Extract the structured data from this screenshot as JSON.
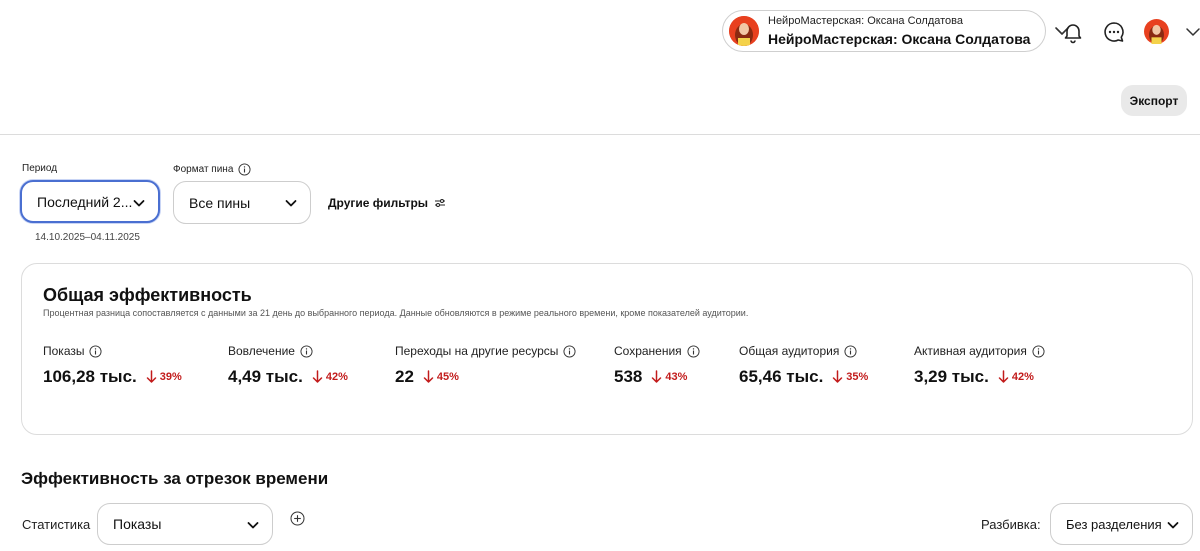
{
  "header": {
    "account_small": "НейроМастерская: Оксана Солдатова",
    "account_main": "НейроМастерская: Оксана Солдатова",
    "icons": [
      "bell-icon",
      "chat-icon",
      "profile-avatar",
      "chevron-down-icon"
    ],
    "export_label": "Экспорт"
  },
  "filters": {
    "period_label": "Период",
    "period_value": "Последний 2...",
    "period_range": "14.10.2025–04.11.2025",
    "format_label": "Формат пина",
    "format_value": "Все пины",
    "other_filters_label": "Другие фильтры"
  },
  "overview": {
    "title": "Общая эффективность",
    "subtitle": "Процентная разница сопоставляется с данными за 21 день до выбранного периода. Данные обновляются в режиме реального времени, кроме показателей аудитории.",
    "metrics": [
      {
        "label": "Показы",
        "value": "106,28 тыс.",
        "change": "39%"
      },
      {
        "label": "Вовлечение",
        "value": "4,49 тыс.",
        "change": "42%"
      },
      {
        "label": "Переходы на другие ресурсы",
        "value": "22",
        "change": "45%"
      },
      {
        "label": "Сохранения",
        "value": "538",
        "change": "43%"
      },
      {
        "label": "Общая аудитория",
        "value": "65,46 тыс.",
        "change": "35%"
      },
      {
        "label": "Активная аудитория",
        "value": "3,29 тыс.",
        "change": "42%"
      }
    ]
  },
  "timeline": {
    "title": "Эффективность за отрезок времени",
    "stat_label": "Статистика",
    "stat_value": "Показы",
    "split_label": "Разбивка:",
    "split_value": "Без разделения"
  },
  "colors": {
    "accent_focus": "#4a6fd1",
    "decrease_red": "#c21b1b",
    "button_gray": "#e9e9e9"
  }
}
